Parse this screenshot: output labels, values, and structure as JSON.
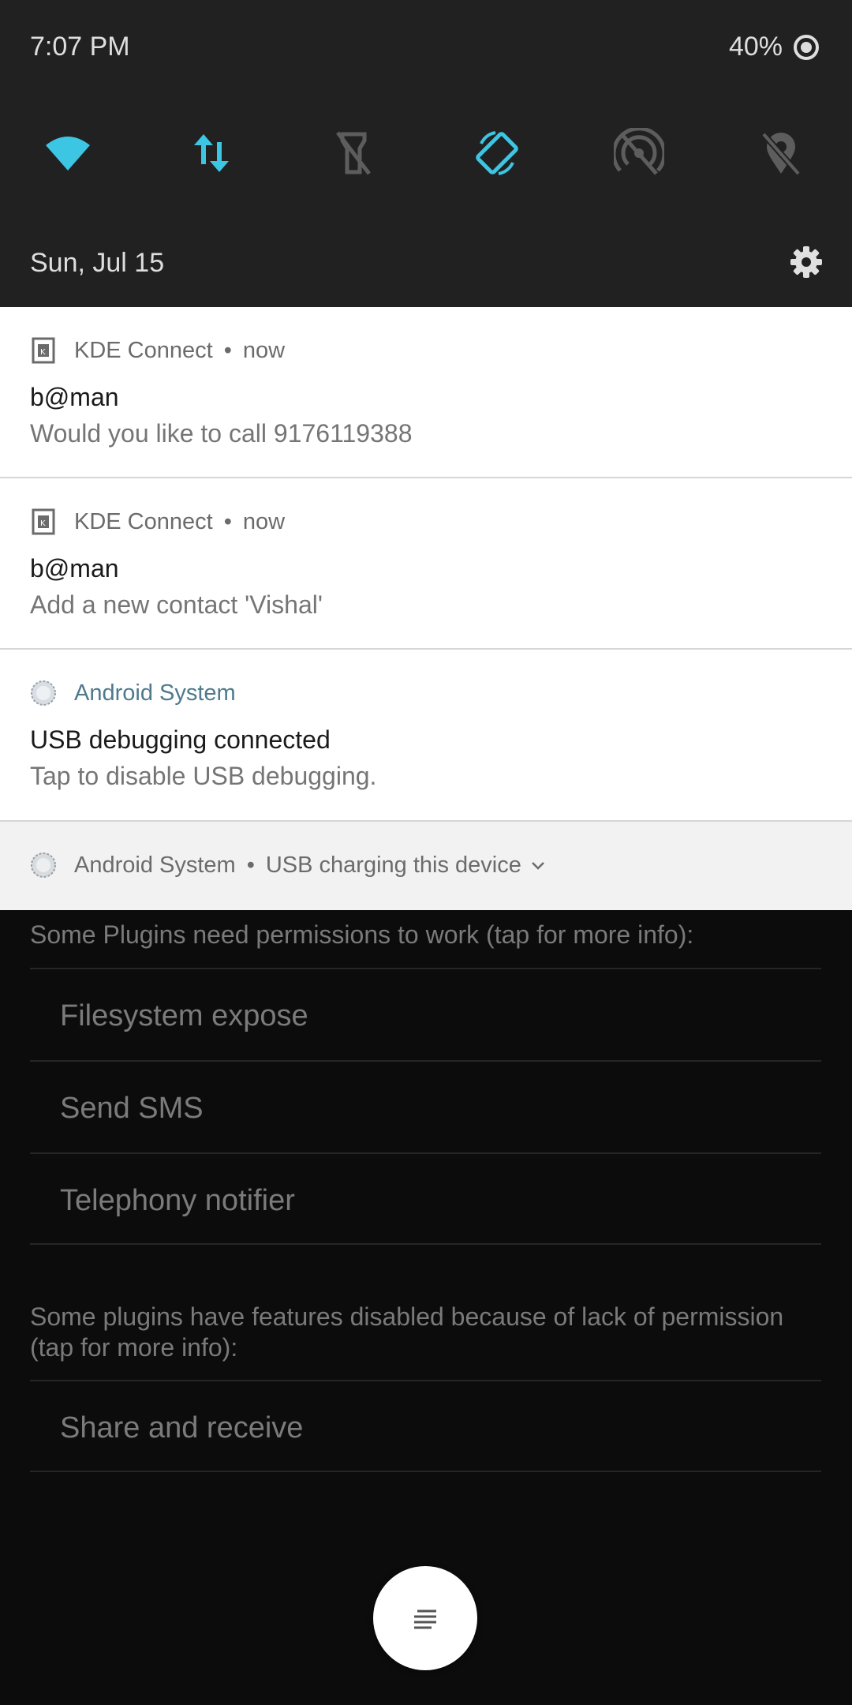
{
  "status_bar": {
    "time": "7:07 PM",
    "battery": "40%",
    "battery_icon": "battery-saver-ring-icon"
  },
  "quick_settings": {
    "tiles": [
      {
        "name": "wifi-icon",
        "state": "on"
      },
      {
        "name": "mobile-data-icon",
        "state": "on"
      },
      {
        "name": "flashlight-icon",
        "state": "off"
      },
      {
        "name": "auto-rotate-icon",
        "state": "on"
      },
      {
        "name": "hotspot-icon",
        "state": "off"
      },
      {
        "name": "location-icon",
        "state": "off"
      }
    ],
    "date": "Sun, Jul 15",
    "settings_icon": "gear-icon",
    "accent_color": "#3cc6e4"
  },
  "notifications": [
    {
      "app": "KDE Connect",
      "time": "now",
      "title": "b@man",
      "text": "Would you like to call 9176119388"
    },
    {
      "app": "KDE Connect",
      "time": "now",
      "title": "b@man",
      "text": "Add a new contact 'Vishal'"
    },
    {
      "app": "Android System",
      "title": "USB debugging connected",
      "text": "Tap to disable USB debugging."
    }
  ],
  "collapsed_notification": {
    "app": "Android System",
    "summary": "USB charging this device"
  },
  "background_app": {
    "permissions_note": "Some Plugins need permissions to work (tap for more info):",
    "plugins_needing_permission": [
      "Filesystem expose",
      "Send SMS",
      "Telephony notifier"
    ],
    "disabled_note": "Some plugins have features disabled because of lack of permission (tap for more info):",
    "plugins_disabled": [
      "Share and receive"
    ],
    "fab_icon": "menu-lines-icon"
  }
}
